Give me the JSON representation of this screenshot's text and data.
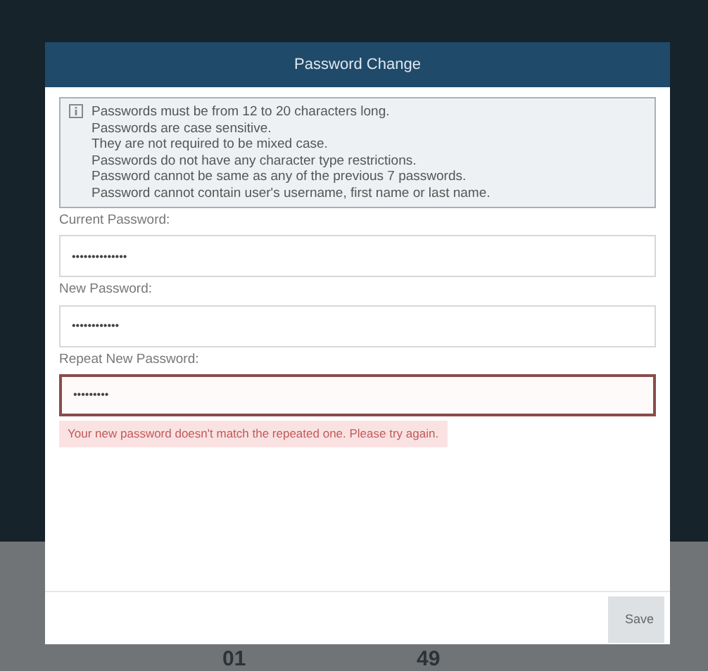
{
  "background": {
    "numbers": [
      "01",
      "49"
    ]
  },
  "dialog": {
    "title": "Password Change",
    "info_lines": [
      "Passwords must be from 12 to 20 characters long.",
      "Passwords are case sensitive.",
      "They are not required to be mixed case.",
      "Passwords do not have any character type restrictions.",
      "Password cannot be same as any of the previous 7 passwords.",
      "Password cannot contain user's username, first name or last name."
    ],
    "fields": [
      {
        "label": "Current Password:",
        "value": "••••••••••••••",
        "invalid": false
      },
      {
        "label": "New Password:",
        "value": "••••••••••••",
        "invalid": false
      },
      {
        "label": "Repeat New Password:",
        "value": "•••••••••",
        "invalid": true
      }
    ],
    "error": "Your new password doesn't match the repeated one. Please try again.",
    "buttons": [
      "Save"
    ]
  }
}
